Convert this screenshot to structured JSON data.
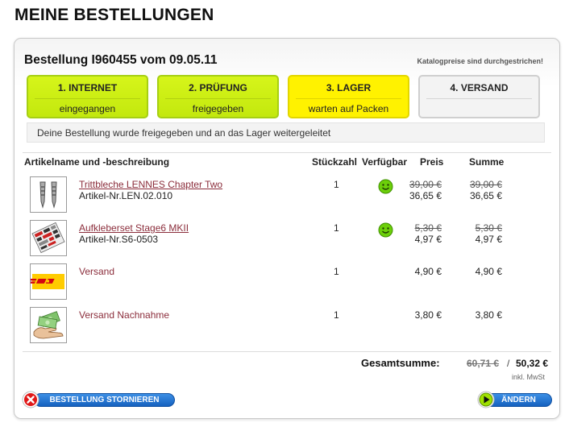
{
  "page": {
    "title": "MEINE BESTELLUNGEN"
  },
  "order": {
    "title": "Bestellung I960455 vom 09.05.11",
    "catalog_note": "Katalogpreise sind durchgestrichen!",
    "info": "Deine Bestellung wurde freigegeben und an das Lager weitergeleitet"
  },
  "steps": [
    {
      "name": "1. INTERNET",
      "status": "eingegangen",
      "color": "#c8ec12"
    },
    {
      "name": "2. PRÜFUNG",
      "status": "freigegeben",
      "color": "#c8ec12"
    },
    {
      "name": "3. LAGER",
      "status": "warten auf Packen",
      "color": "#fff200"
    },
    {
      "name": "4. VERSAND",
      "status": "",
      "color": "#f3f3f3"
    }
  ],
  "table": {
    "headers": {
      "article": "Artikelname und -beschreibung",
      "qty": "Stückzahl",
      "avail": "Verfügbar",
      "price": "Preis",
      "sum": "Summe"
    },
    "rows": [
      {
        "name": "Trittbleche LENNES Chapter Two",
        "sku": "Artikel-Nr.LEN.02.010",
        "qty": "1",
        "available": true,
        "price_old": "39,00 €",
        "price": "36,65 €",
        "sum_old": "39,00 €",
        "sum": "36,65 €",
        "thumb_icon": "footpegs-thumbnail"
      },
      {
        "name": "Aufkleberset Stage6 MKII",
        "sku": "Artikel-Nr.S6-0503",
        "qty": "1",
        "available": true,
        "price_old": "5,30 €",
        "price": "4,97 €",
        "sum_old": "5,30 €",
        "sum": "4,97 €",
        "thumb_icon": "sticker-set-thumbnail"
      },
      {
        "name": "Versand",
        "sku": "",
        "qty": "1",
        "available": false,
        "price_old": "",
        "price": "4,90 €",
        "sum_old": "",
        "sum": "4,90 €",
        "thumb_icon": "dhl-logo"
      },
      {
        "name": "Versand Nachnahme",
        "sku": "",
        "qty": "1",
        "available": false,
        "price_old": "",
        "price": "3,80 €",
        "sum_old": "",
        "sum": "3,80 €",
        "thumb_icon": "cash-on-delivery-icon"
      }
    ]
  },
  "totals": {
    "label": "Gesamtsumme:",
    "old": "60,71 €",
    "separator": "/",
    "new": "50,32 €",
    "vat_note": "inkl. MwSt"
  },
  "buttons": {
    "cancel_label": "BESTELLUNG STORNIEREN",
    "change_label": "ÄNDERN"
  },
  "colors": {
    "accent_blue": "#1e6fd0",
    "link": "#8b2d3b",
    "smiley": "#66cc00"
  }
}
